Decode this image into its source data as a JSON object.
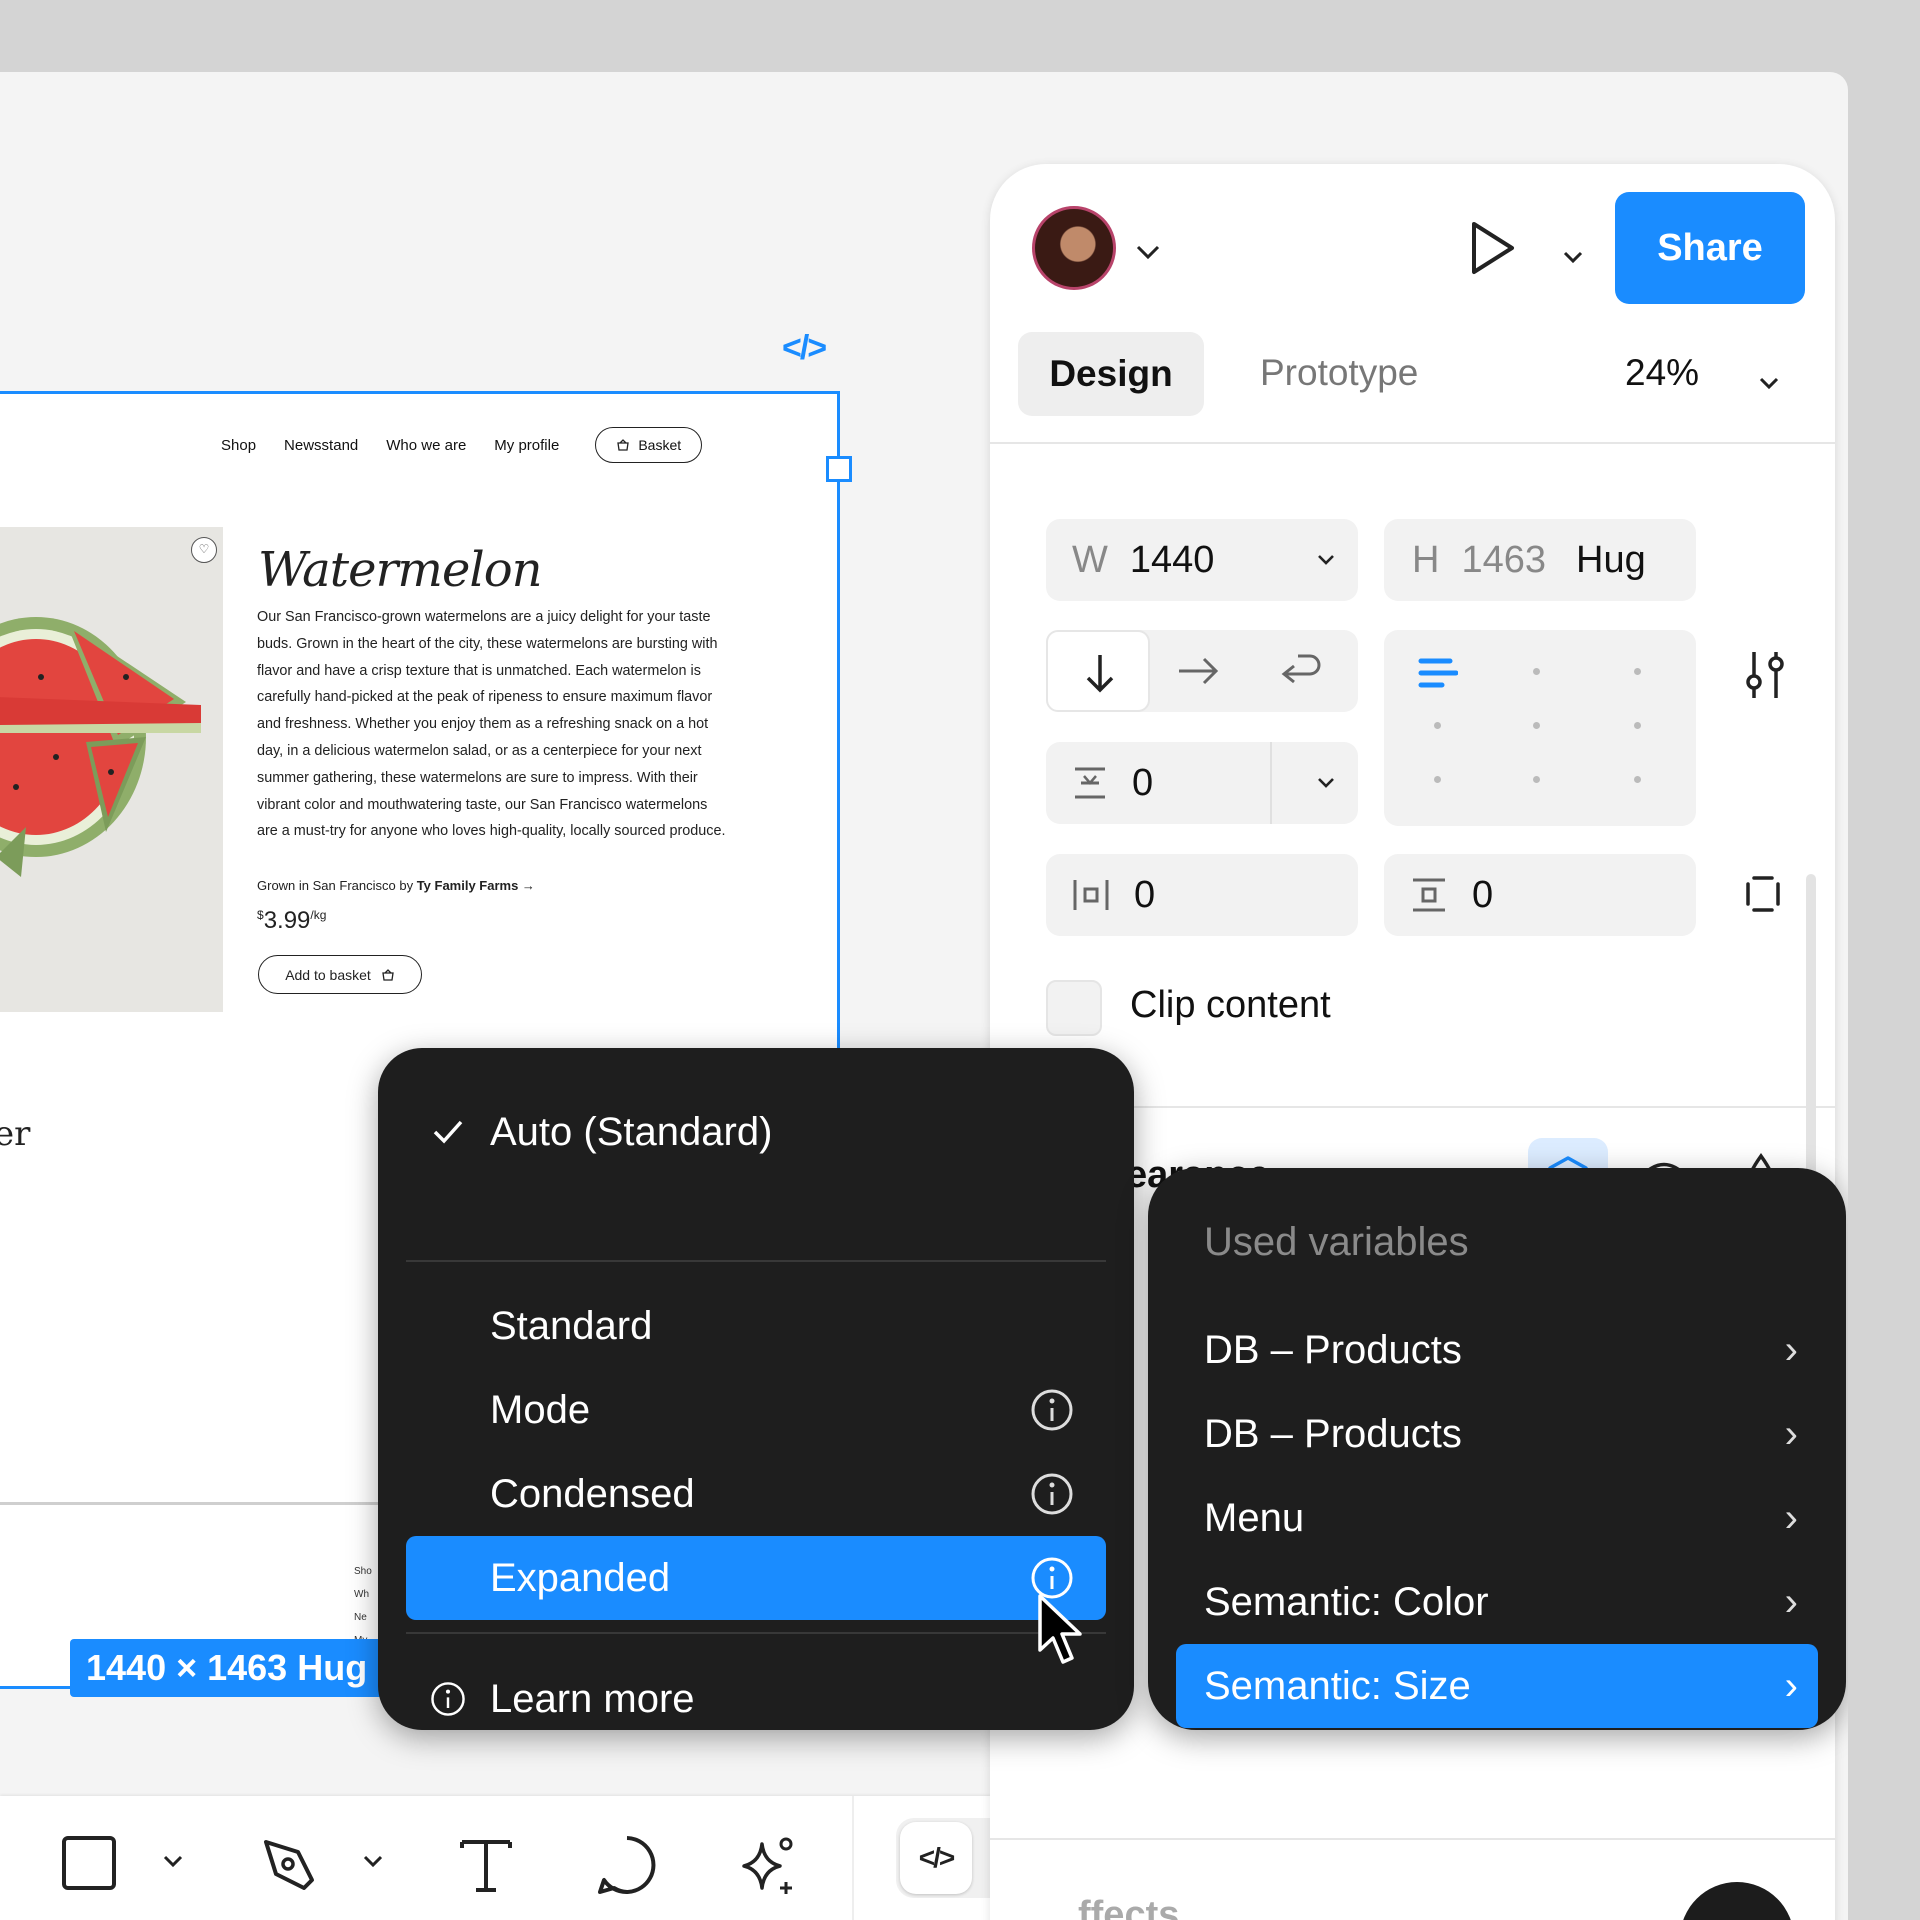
{
  "canvas": {
    "code_badge": "</>",
    "frame": {
      "nav": [
        "Shop",
        "Newsstand",
        "Who we are",
        "My profile"
      ],
      "basket_label": "Basket",
      "product": {
        "title": "Watermelon",
        "description": "Our San Francisco-grown watermelons are a juicy delight for your taste buds. Grown in the heart of the city, these watermelons are bursting with flavor and have a crisp texture that is unmatched. Each watermelon is carefully hand-picked at the peak of ripeness to ensure maximum flavor and freshness. Whether you enjoy them as a refreshing snack on a hot day, in a delicious watermelon salad, or as a centerpiece for your next summer gathering, these watermelons are sure to impress. With their vibrant color and mouthwatering taste, our San Francisco watermelons are a must-try for anyone who loves high-quality, locally sourced produce.",
        "grown_prefix": "Grown in San Francisco by ",
        "farm": "Ty Family Farms →",
        "price_currency": "$",
        "price_value": "3.99",
        "price_unit": "/kg",
        "add_to_basket": "Add to basket"
      },
      "partial_text": "er",
      "footer_links": [
        "Sho",
        "Wh",
        "Ne",
        "My"
      ]
    },
    "size_tag": "1440 × 1463 Hug"
  },
  "panel": {
    "share": "Share",
    "tabs": {
      "design": "Design",
      "prototype": "Prototype"
    },
    "zoom": "24%",
    "auto_layout": {
      "width_label": "W",
      "width_value": "1440",
      "height_label": "H",
      "height_value": "1463",
      "height_mode": "Hug",
      "gap": "0",
      "padding_h": "0",
      "padding_v": "0",
      "clip_content": "Clip content"
    },
    "appearance_partial": "earance",
    "effects_partial": "ffects",
    "help": "?"
  },
  "menu_left": {
    "checked_item": "Auto (Standard)",
    "items": [
      {
        "label": "Standard",
        "info": false
      },
      {
        "label": "Mode",
        "info": true
      },
      {
        "label": "Condensed",
        "info": true
      },
      {
        "label": "Expanded",
        "info": true,
        "selected": true
      }
    ],
    "learn_more": "Learn more"
  },
  "menu_right": {
    "header": "Used variables",
    "items": [
      "DB – Products",
      "DB – Products",
      "Menu",
      "Semantic: Color",
      "Semantic: Size"
    ],
    "selected_index": 4
  },
  "colors": {
    "accent": "#1a8cff",
    "menu_bg": "#1e1e1e",
    "panel_bg": "#ffffff",
    "canvas_bg": "#f4f4f4"
  }
}
